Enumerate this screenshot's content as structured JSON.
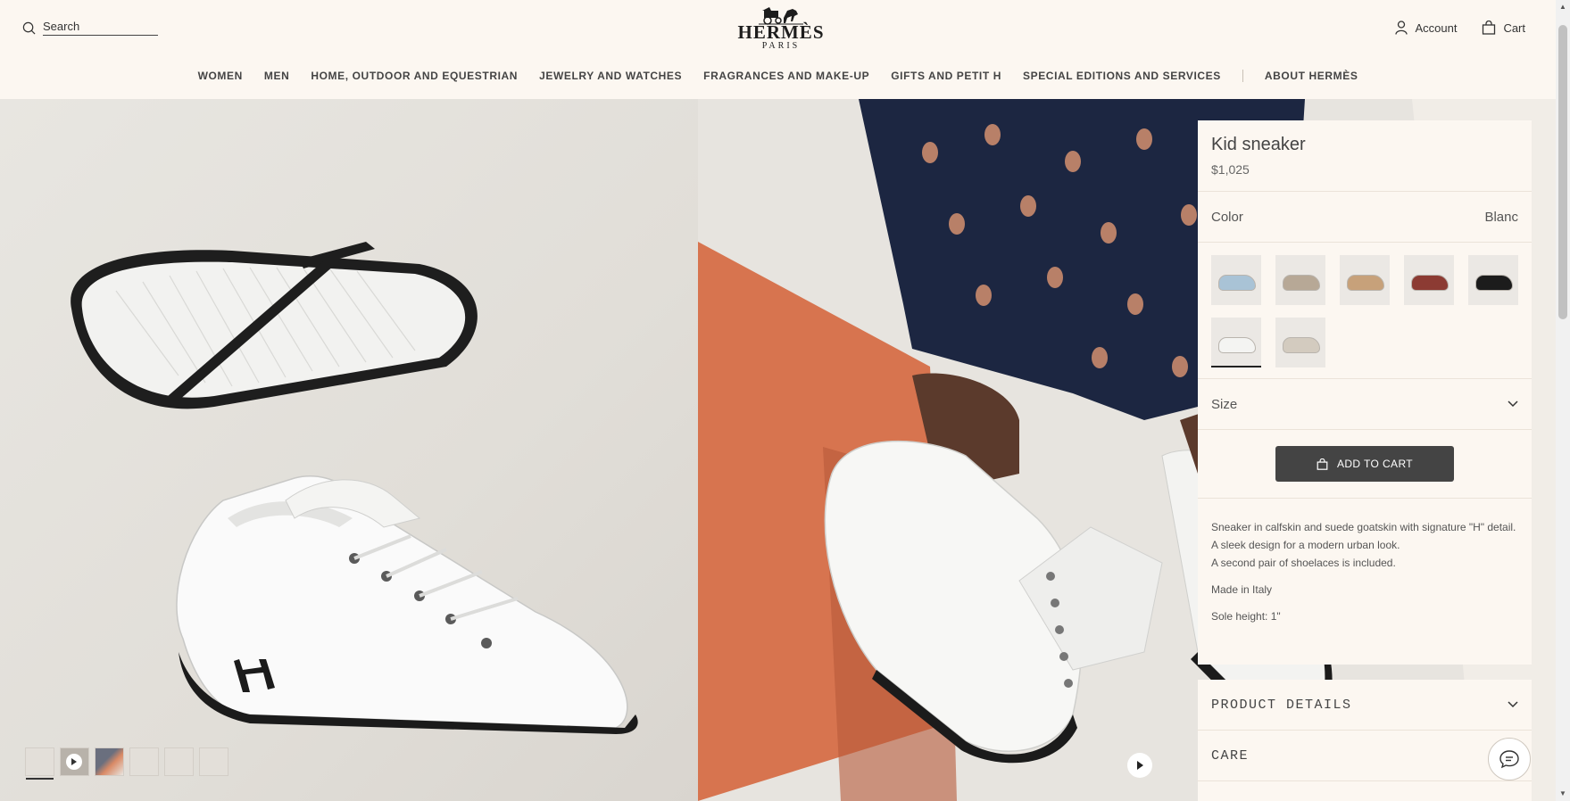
{
  "header": {
    "search_label": "Search",
    "logo": {
      "wordmark": "HERMÈS",
      "sub": "PARIS"
    },
    "account_label": "Account",
    "cart_label": "Cart"
  },
  "nav": {
    "items": [
      "WOMEN",
      "MEN",
      "HOME, OUTDOOR AND EQUESTRIAN",
      "JEWELRY AND WATCHES",
      "FRAGRANCES AND MAKE-UP",
      "GIFTS AND PETIT H",
      "SPECIAL EDITIONS AND SERVICES"
    ],
    "about": "ABOUT HERMÈS"
  },
  "gallery": {
    "thumbnail_count": 6,
    "active_thumbnail": 1,
    "video_thumbnail": 2
  },
  "product": {
    "name": "Kid sneaker",
    "price": "$1,025",
    "color_label": "Color",
    "color_value": "Blanc",
    "swatches": [
      {
        "name": "blue",
        "color": "#a9c3d6"
      },
      {
        "name": "taupe",
        "color": "#b7a896"
      },
      {
        "name": "camel",
        "color": "#c7a17a"
      },
      {
        "name": "burgundy",
        "color": "#8c3b33"
      },
      {
        "name": "black",
        "color": "#1c1c1c"
      },
      {
        "name": "white",
        "color": "#f4f4f2",
        "selected": true
      },
      {
        "name": "beige",
        "color": "#d3cbbf"
      }
    ],
    "size_label": "Size",
    "add_to_cart": "ADD TO CART",
    "description": [
      "Sneaker in calfskin and suede goatskin with signature \"H\" detail.",
      "A sleek design for a modern urban look.",
      "A second pair of shoelaces is included."
    ],
    "made_in": "Made in Italy",
    "sole_height": "Sole height: 1\""
  },
  "sections": {
    "product_details": "PRODUCT DETAILS",
    "care": "CARE"
  },
  "colors": {
    "background": "#fcf7f1",
    "text": "#444444",
    "button": "#444444"
  }
}
